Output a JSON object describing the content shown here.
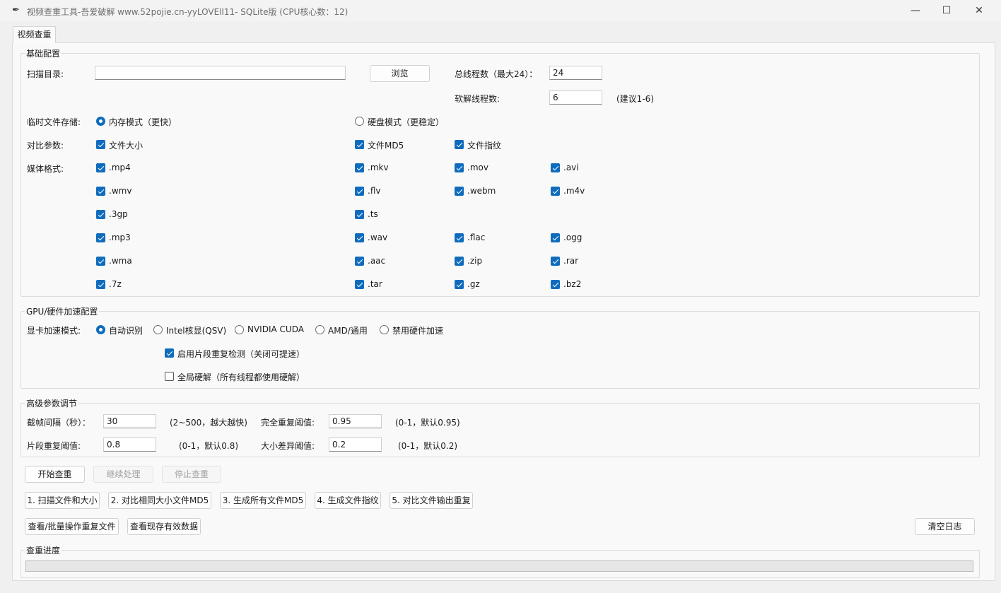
{
  "window": {
    "title": "视频查重工具-吾爱破解 www.52pojie.cn-yyLOVEll11- SQLite版 (CPU核心数：12)",
    "controls": {
      "minimize": "—",
      "maximize": "☐",
      "close": "✕"
    }
  },
  "tab": {
    "label": "视频查重"
  },
  "basic": {
    "title": "基础配置",
    "scan_dir_label": "扫描目录:",
    "scan_dir_value": "",
    "browse_label": "浏览",
    "total_threads_label": "总线程数（最大24）：",
    "total_threads_value": "24",
    "soft_threads_label": "软解线程数:",
    "soft_threads_value": "6",
    "soft_threads_hint": "(建议1-6)",
    "temp_storage_label": "临时文件存储:",
    "temp_storage_options": [
      {
        "label": "内存模式（更快）",
        "selected": true
      },
      {
        "label": "硬盘模式（更稳定）",
        "selected": false
      }
    ],
    "compare_label": "对比参数:",
    "compare_options": [
      {
        "label": "文件大小",
        "checked": true
      },
      {
        "label": "文件MD5",
        "checked": true
      },
      {
        "label": "文件指纹",
        "checked": true
      }
    ],
    "media_label": "媒体格式:",
    "media_formats": [
      [
        ".mp4",
        ".mkv",
        ".mov",
        ".avi"
      ],
      [
        ".wmv",
        ".flv",
        ".webm",
        ".m4v"
      ],
      [
        ".3gp",
        ".ts"
      ],
      [
        ".mp3",
        ".wav",
        ".flac",
        ".ogg"
      ],
      [
        ".wma",
        ".aac",
        ".zip",
        ".rar"
      ],
      [
        ".7z",
        ".tar",
        ".gz",
        ".bz2"
      ]
    ]
  },
  "gpu": {
    "title": "GPU/硬件加速配置",
    "mode_label": "显卡加速模式:",
    "modes": [
      {
        "label": "自动识别",
        "selected": true
      },
      {
        "label": "Intel核显(QSV)",
        "selected": false
      },
      {
        "label": "NVIDIA CUDA",
        "selected": false
      },
      {
        "label": "AMD/通用",
        "selected": false
      },
      {
        "label": "禁用硬件加速",
        "selected": false
      }
    ],
    "segment_check": {
      "label": "启用片段重复检测（关闭可提速）",
      "checked": true
    },
    "global_hw": {
      "label": "全局硬解（所有线程都使用硬解）",
      "checked": false
    }
  },
  "advanced": {
    "title": "高级参数调节",
    "frame_interval_label": "截帧间隔（秒）：",
    "frame_interval_value": "30",
    "frame_interval_hint": "(2~500，越大越快)",
    "full_dup_label": "完全重复阈值:",
    "full_dup_value": "0.95",
    "full_dup_hint": "(0-1，默认0.95)",
    "segment_dup_label": "片段重复阈值:",
    "segment_dup_value": "0.8",
    "segment_dup_hint": "(0-1，默认0.8)",
    "size_diff_label": "大小差异阈值:",
    "size_diff_value": "0.2",
    "size_diff_hint": "(0-1，默认0.2)"
  },
  "actions": {
    "start": "开始查重",
    "resume": "继续处理",
    "stop": "停止查重",
    "steps": [
      "1. 扫描文件和大小",
      "2. 对比相同大小文件MD5",
      "3. 生成所有文件MD5",
      "4. 生成文件指纹",
      "5. 对比文件输出重复"
    ],
    "view_duplicates": "查看/批量操作重复文件",
    "view_valid": "查看现存有效数据",
    "clear_log": "清空日志"
  },
  "progress": {
    "title": "查重进度",
    "value": 0
  },
  "colors": {
    "accent": "#0f6cbd",
    "progress": "#06b025"
  }
}
